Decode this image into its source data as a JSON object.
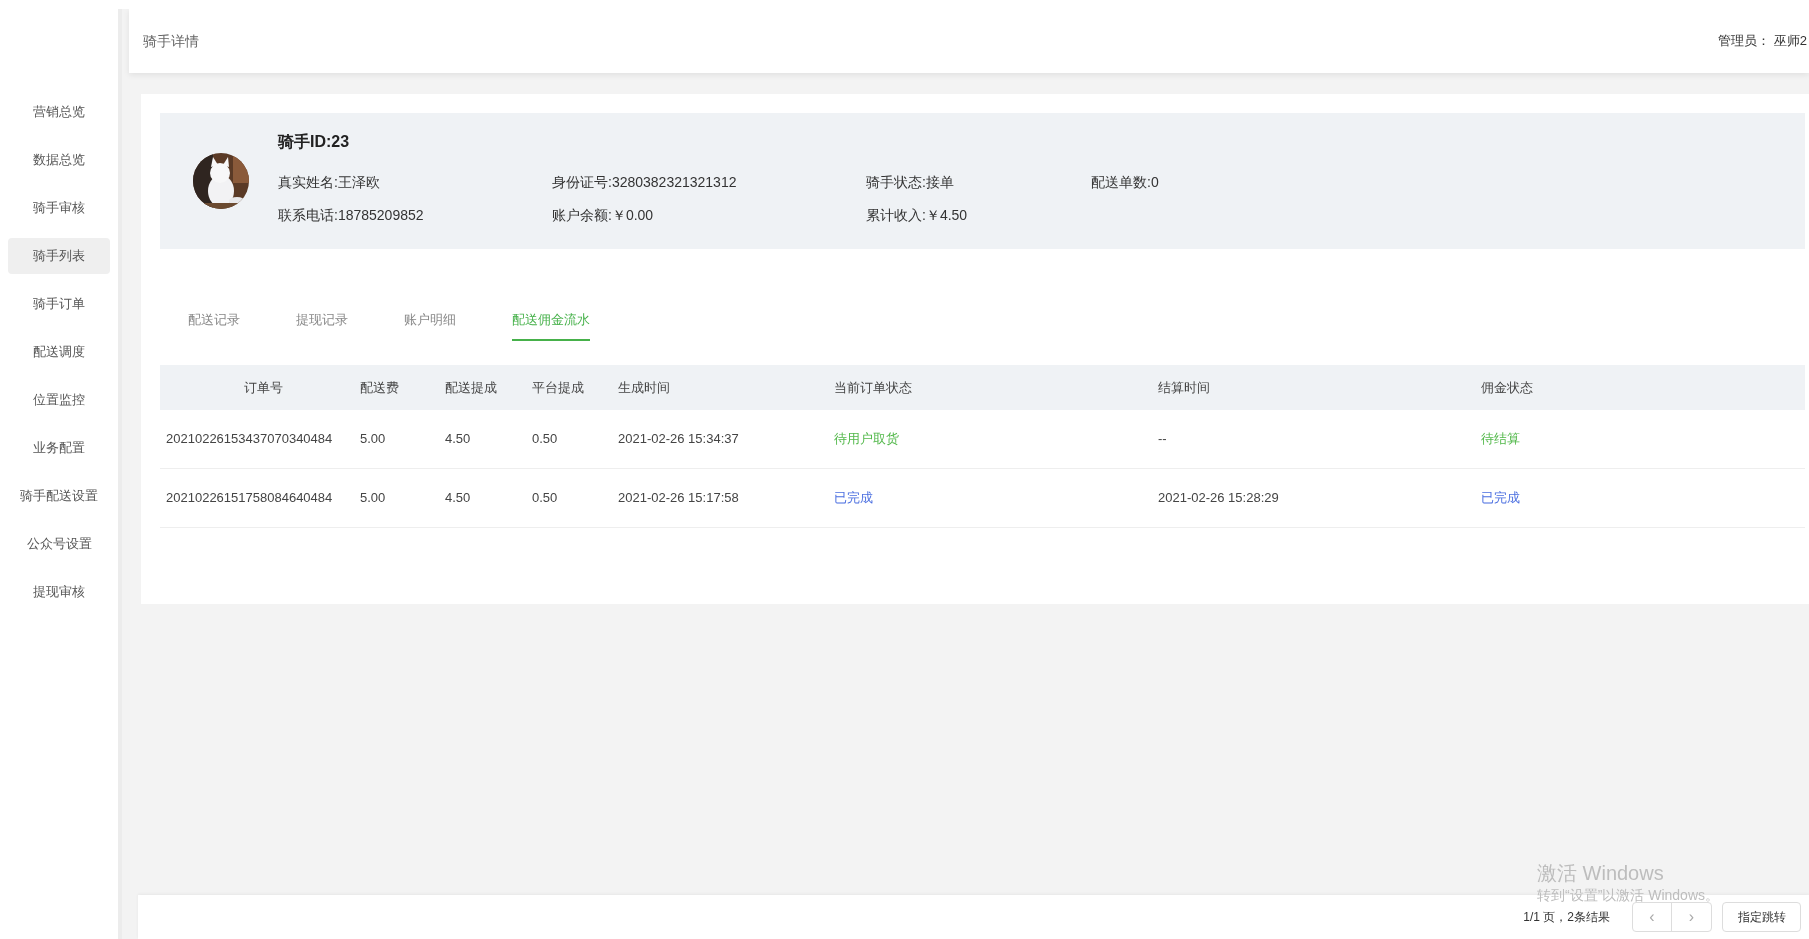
{
  "sidebar": {
    "items": [
      {
        "label": "营销总览",
        "selected": false
      },
      {
        "label": "数据总览",
        "selected": false
      },
      {
        "label": "骑手审核",
        "selected": false
      },
      {
        "label": "骑手列表",
        "selected": true
      },
      {
        "label": "骑手订单",
        "selected": false
      },
      {
        "label": "配送调度",
        "selected": false
      },
      {
        "label": "位置监控",
        "selected": false
      },
      {
        "label": "业务配置",
        "selected": false
      },
      {
        "label": "骑手配送设置",
        "selected": false
      },
      {
        "label": "公众号设置",
        "selected": false
      },
      {
        "label": "提现审核",
        "selected": false
      }
    ]
  },
  "header": {
    "title": "骑手详情",
    "admin_label": "管理员：",
    "admin_name": "巫师2"
  },
  "profile": {
    "avatar": {
      "kind": "picture"
    },
    "rider_id": "骑手ID:23",
    "fields": [
      [
        "真实姓名:王泽欧",
        "身份证号:3280382321321312",
        "骑手状态:接单",
        "配送单数:0"
      ],
      [
        "联系电话:18785209852",
        "账户余额:￥0.00",
        "累计收入:￥4.50"
      ]
    ]
  },
  "tabs": [
    {
      "label": "配送记录",
      "selected": false
    },
    {
      "label": "提现记录",
      "selected": false
    },
    {
      "label": "账户明细",
      "selected": false
    },
    {
      "label": "配送佣金流水",
      "selected": true
    }
  ],
  "table": {
    "columns": [
      "订单号",
      "配送费",
      "配送提成",
      "平台提成",
      "生成时间",
      "当前订单状态",
      "结算时间",
      "佣金状态"
    ],
    "rows": [
      {
        "cells": [
          "20210226153437070340484",
          "5.00",
          "4.50",
          "0.50",
          "2021-02-26 15:34:37",
          {
            "text": "待用户取货",
            "color": "#52b84a"
          },
          "--",
          {
            "text": "待结算",
            "color": "#52b84a"
          }
        ]
      },
      {
        "cells": [
          "20210226151758084640484",
          "5.00",
          "4.50",
          "0.50",
          "2021-02-26 15:17:58",
          {
            "text": "已完成",
            "color": "#4a6ee0"
          },
          "2021-02-26 15:28:29",
          {
            "text": "已完成",
            "color": "#4a6ee0"
          }
        ]
      }
    ]
  },
  "pagination": {
    "summary": "1/1 页，2条结果",
    "prev": "‹",
    "next": "›",
    "jump": "指定跳转"
  },
  "os_notice": {
    "title": "激活 Windows",
    "subtitle": "转到“设置”以激活 Windows。"
  }
}
